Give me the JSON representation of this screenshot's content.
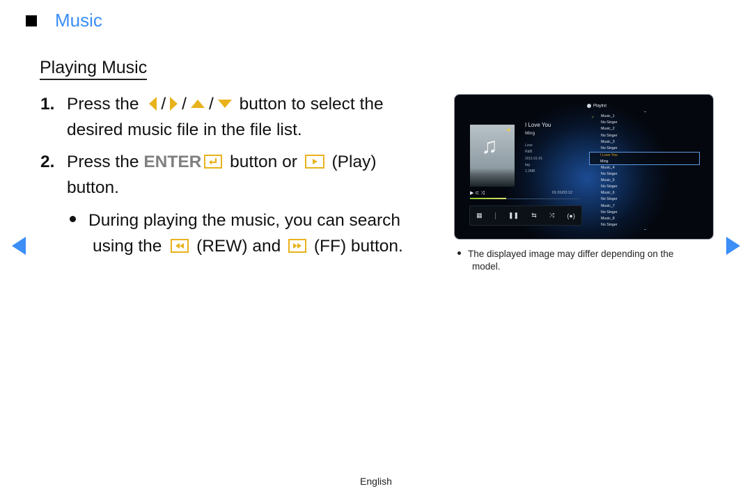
{
  "section": {
    "title": "Music",
    "marker_icon": "black-square"
  },
  "subtitle": "Playing Music",
  "steps": [
    {
      "number": "1.",
      "prefix": "Press the",
      "icons": [
        "left-arrow",
        "right-arrow",
        "up-arrow",
        "down-arrow"
      ],
      "separator": "/",
      "suffix_line1": "button to select the",
      "line2": "desired music file in the file list."
    },
    {
      "number": "2.",
      "prefix": "Press the",
      "enter_label": "ENTER",
      "enter_icon": "enter-key",
      "middle": "button or",
      "play_icon": "play-key",
      "play_label": "(Play)",
      "line2": "button."
    }
  ],
  "bullet": {
    "line1": "During playing the music, you can search",
    "prefix2": "using the",
    "rew_icon": "rewind-key",
    "rew_label": "(REW) and",
    "ff_icon": "fast-forward-key",
    "ff_label": "(FF) button."
  },
  "nav": {
    "prev_icon": "previous-page-arrow",
    "next_icon": "next-page-arrow",
    "color": "#3a8ef6"
  },
  "accent_color": "#e8b21c",
  "tv_screen": {
    "now_playing": {
      "song": "I Love You",
      "artist": "Ming",
      "meta": [
        "Love",
        "R&B",
        "2011-01-01",
        "tag",
        "1.2MB"
      ],
      "time": "01:01/03:12",
      "progress_fraction": 0.33,
      "mini_icons": [
        "play-icon",
        "repeat-icon",
        "shuffle-icon"
      ],
      "favorite_icon": "star-icon"
    },
    "controls": [
      "grid-icon",
      "pause-icon",
      "repeat-icon",
      "shuffle-icon",
      "sound-mode-icon"
    ],
    "playlist": {
      "title": "Playlist",
      "items": [
        {
          "title": "Music_1",
          "artist": "No Singer",
          "checked": true
        },
        {
          "title": "Music_2",
          "artist": "No Singer"
        },
        {
          "title": "Music_3",
          "artist": "No Singer"
        },
        {
          "title": "I Love You",
          "artist": "Ming",
          "selected": true
        },
        {
          "title": "Music_4",
          "artist": "No Singer"
        },
        {
          "title": "Music_5",
          "artist": "No Singer"
        },
        {
          "title": "Music_6",
          "artist": "No Singer"
        },
        {
          "title": "Music_7",
          "artist": "No Singer"
        },
        {
          "title": "Music_8",
          "artist": "No Singer"
        }
      ]
    }
  },
  "note": {
    "line1": "The displayed image may differ depending on the",
    "line2": "model."
  },
  "footer": "English"
}
